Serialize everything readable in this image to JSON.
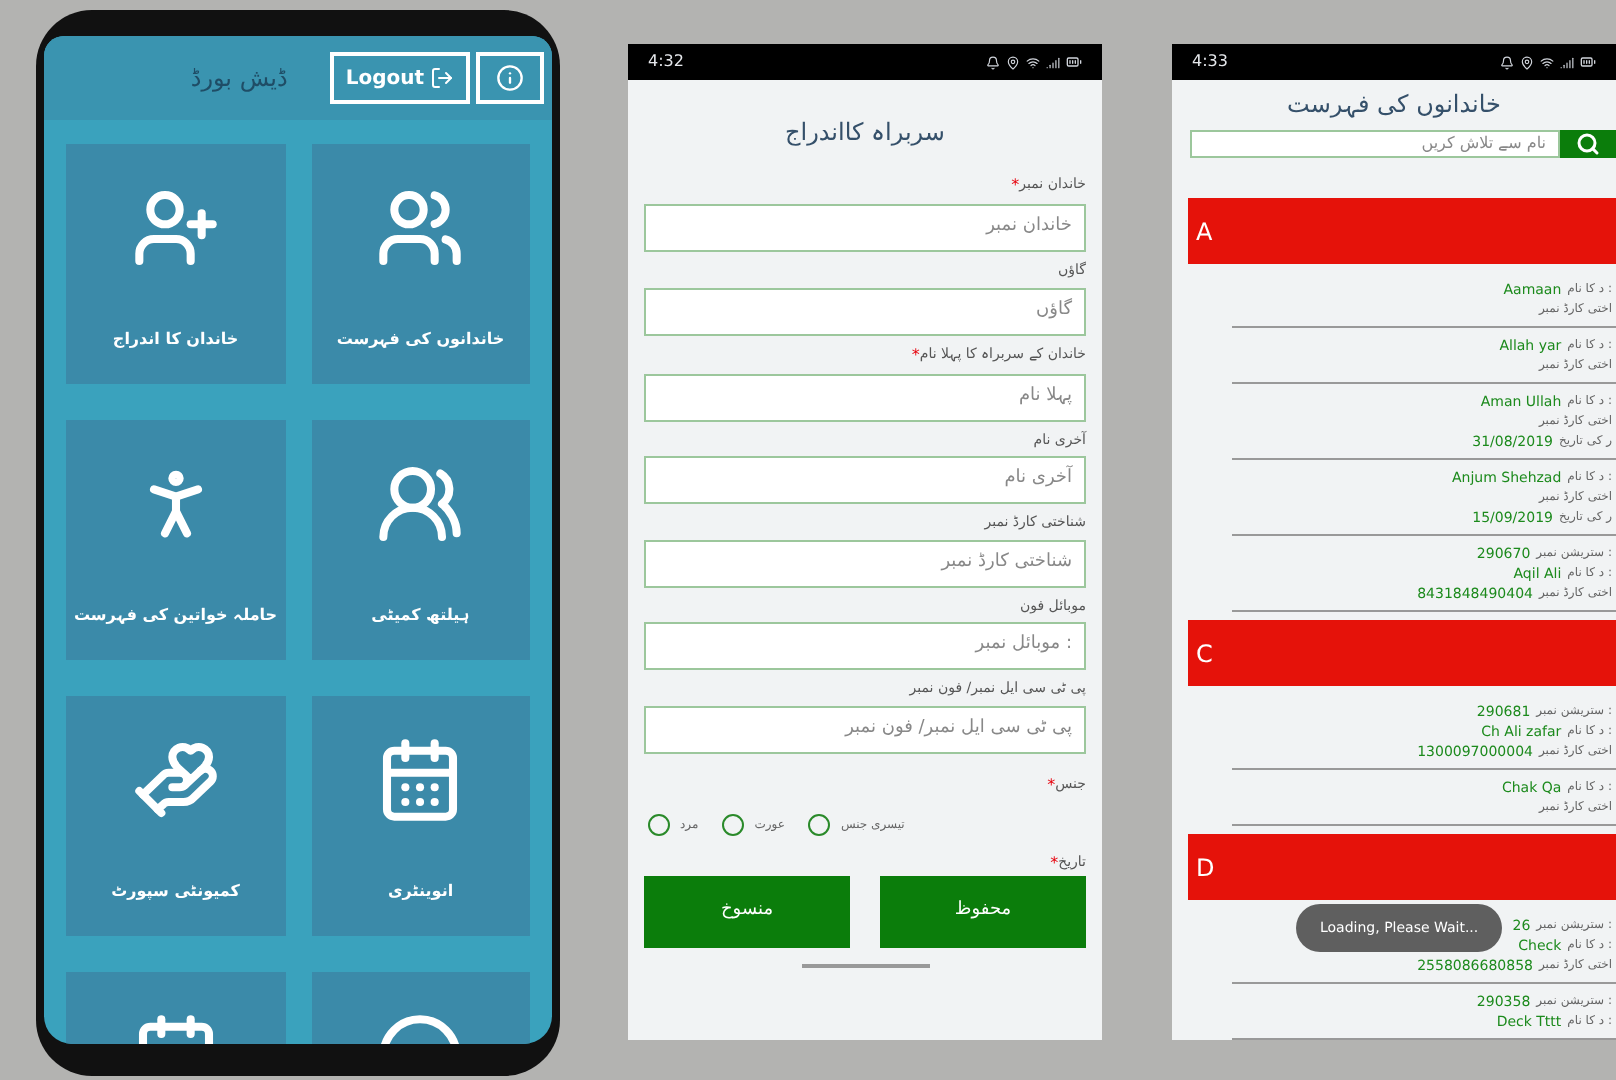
{
  "dashboard": {
    "title": "ڈیش بورڈ",
    "logout_button": "Logout",
    "tiles": [
      {
        "kind": "list",
        "label": "خاندانوں کی فہرست"
      },
      {
        "kind": "add",
        "label": "خاندان کا اندراج"
      },
      {
        "kind": "committee",
        "label": "ہیلتھ کمیٹی"
      },
      {
        "kind": "woman",
        "label": "حاملہ خواتین کی فہرست"
      },
      {
        "kind": "calendar",
        "label": "انوینٹری"
      },
      {
        "kind": "support",
        "label": "کمیونٹی سپورٹ"
      },
      {
        "kind": "ring"
      },
      {
        "kind": "calendar"
      }
    ]
  },
  "registration": {
    "status_time": "4:32",
    "title": "سربراہ کااندراج",
    "fields": [
      {
        "label": "خاندان نمبر",
        "mark": "*",
        "placeholder": "خاندان نمبر"
      },
      {
        "label": "گاؤں",
        "placeholder": "گاؤں"
      },
      {
        "label": "خاندان کے سربراہ کا پہلا نام",
        "mark": "*",
        "placeholder": "پہلا نام"
      },
      {
        "label": "آخری نام",
        "placeholder": "آخری نام"
      },
      {
        "label": "شناختی کارڈ نمبر",
        "placeholder": "شناختی کارڈ نمبر"
      },
      {
        "label": "موبائل فون",
        "placeholder": "موبائل نمبر :"
      },
      {
        "label": "پی ٹی سی ایل نمبر/ فون نمبر",
        "placeholder": "پی ٹی سی ایل نمبر/ فون نمبر"
      }
    ],
    "gender": {
      "label": "جنس",
      "mark": "*",
      "options": [
        {
          "label": "تیسری جنس",
          "selected": false
        },
        {
          "label": "عورت",
          "selected": false
        },
        {
          "label": "مرد",
          "selected": false
        }
      ]
    },
    "date": {
      "label": "تاریخ",
      "mark": "*"
    },
    "buttons": {
      "cancel": "منسوخ",
      "save": "محفوظ"
    }
  },
  "family_list": {
    "status_time": "4:33",
    "title": "خاندانوں کی فہرست",
    "search": {
      "placeholder": "نام سے تلاش کریں"
    },
    "sections": [
      {
        "letter": "A",
        "entries": [
          [
            {
              "label": "د کا نام :",
              "value": "Aamaan"
            },
            {
              "label": "اختی کارڈ نمبر"
            }
          ],
          [
            {
              "label": "د کا نام :",
              "value": "Allah yar"
            },
            {
              "label": "اختی کارڈ نمبر"
            }
          ],
          [
            {
              "label": "د کا نام :",
              "value": "Aman Ullah"
            },
            {
              "label": "اختی کارڈ نمبر"
            },
            {
              "label": "ر کی تاریخ",
              "value": "31/08/2019"
            }
          ],
          [
            {
              "label": "د کا نام :",
              "value": "Anjum Shehzad"
            },
            {
              "label": "اختی کارڈ نمبر"
            },
            {
              "label": "ر کی تاریخ",
              "value": "15/09/2019"
            }
          ],
          [
            {
              "label": "ستریشن نمبر :",
              "value": "290670"
            },
            {
              "label": "د کا نام :",
              "value": "Aqil Ali"
            },
            {
              "label": "اختی کارڈ نمبر",
              "value": "8431848490404"
            }
          ]
        ]
      },
      {
        "letter": "C",
        "entries": [
          [
            {
              "label": "ستریشن نمبر :",
              "value": "290681"
            },
            {
              "label": "د کا نام :",
              "value": "Ch Ali zafar"
            },
            {
              "label": "اختی کارڈ نمبر",
              "value": "1300097000004"
            }
          ],
          [
            {
              "label": "د کا نام :",
              "value": "Chak Qa"
            },
            {
              "label": "اختی کارڈ نمبر"
            }
          ]
        ]
      },
      {
        "letter": "D",
        "entries": [
          [
            {
              "label": "ستریشن نمبر :",
              "value": "26"
            },
            {
              "label": "د کا نام :",
              "value": "Check"
            },
            {
              "label": "اختی کارڈ نمبر",
              "value": "2558086680858"
            }
          ],
          [
            {
              "label": "ستریشن نمبر :",
              "value": "290358"
            },
            {
              "label": "د کا نام :",
              "value": "Deck Tttt"
            }
          ]
        ]
      }
    ],
    "toast": "Loading, Please Wait..."
  }
}
